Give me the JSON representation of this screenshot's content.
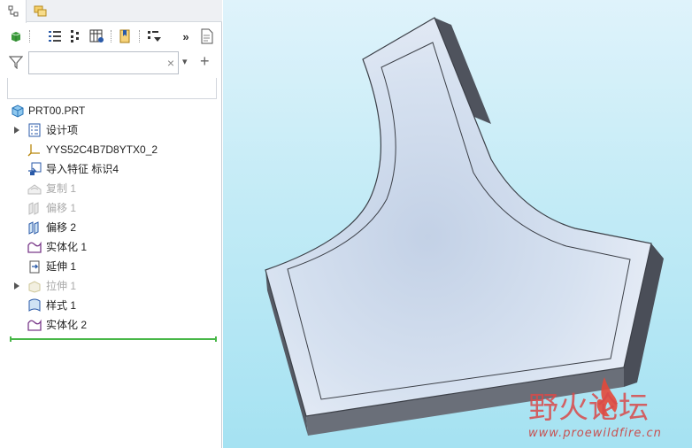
{
  "tabs": [
    {
      "name": "model-tree-tab",
      "icon": "model-tree-icon",
      "active": true
    },
    {
      "name": "layers-tab",
      "icon": "layers-icon",
      "active": false
    }
  ],
  "toolbar": {
    "items": [
      "show-features-icon",
      "tree-settings-icon",
      "tree-filters-icon",
      "columns-icon",
      "bookmark-icon",
      "filter-dropdown-icon",
      "more-icon",
      "details-icon"
    ],
    "more_label": "»"
  },
  "search": {
    "value": "",
    "placeholder": "",
    "clear_label": "×",
    "add_label": "+",
    "dropdown_label": "▾"
  },
  "tree": {
    "root": "PRT00.PRT",
    "items": [
      {
        "label": "设计项",
        "icon": "design-items-icon",
        "expandable": true,
        "dim": false
      },
      {
        "label": "YYS52C4B7D8YTX0_2",
        "icon": "coordinate-system-icon",
        "expandable": false,
        "dim": false
      },
      {
        "label": "导入特征 标识4",
        "icon": "import-feature-icon",
        "expandable": false,
        "dim": false
      },
      {
        "label": "复制 1",
        "icon": "copy-icon",
        "expandable": false,
        "dim": true
      },
      {
        "label": "偏移 1",
        "icon": "offset-icon",
        "expandable": false,
        "dim": true
      },
      {
        "label": "偏移 2",
        "icon": "offset-icon",
        "expandable": false,
        "dim": false
      },
      {
        "label": "实体化 1",
        "icon": "solidify-icon",
        "expandable": false,
        "dim": false
      },
      {
        "label": "延伸 1",
        "icon": "extend-icon",
        "expandable": false,
        "dim": false
      },
      {
        "label": "拉伸 1",
        "icon": "extrude-icon",
        "expandable": true,
        "dim": true
      },
      {
        "label": "样式 1",
        "icon": "style-icon",
        "expandable": false,
        "dim": false
      },
      {
        "label": "实体化 2",
        "icon": "solidify-icon",
        "expandable": false,
        "dim": false
      }
    ]
  },
  "watermark": {
    "logo_text": "野火论坛",
    "url": "www.proewildfire.cn"
  },
  "colors": {
    "accent_green": "#48b748",
    "model_face": "#d8e2f1",
    "model_side": "#4a4e58",
    "viewport_top": "#dff3fb",
    "viewport_bottom": "#a5e2f2"
  }
}
